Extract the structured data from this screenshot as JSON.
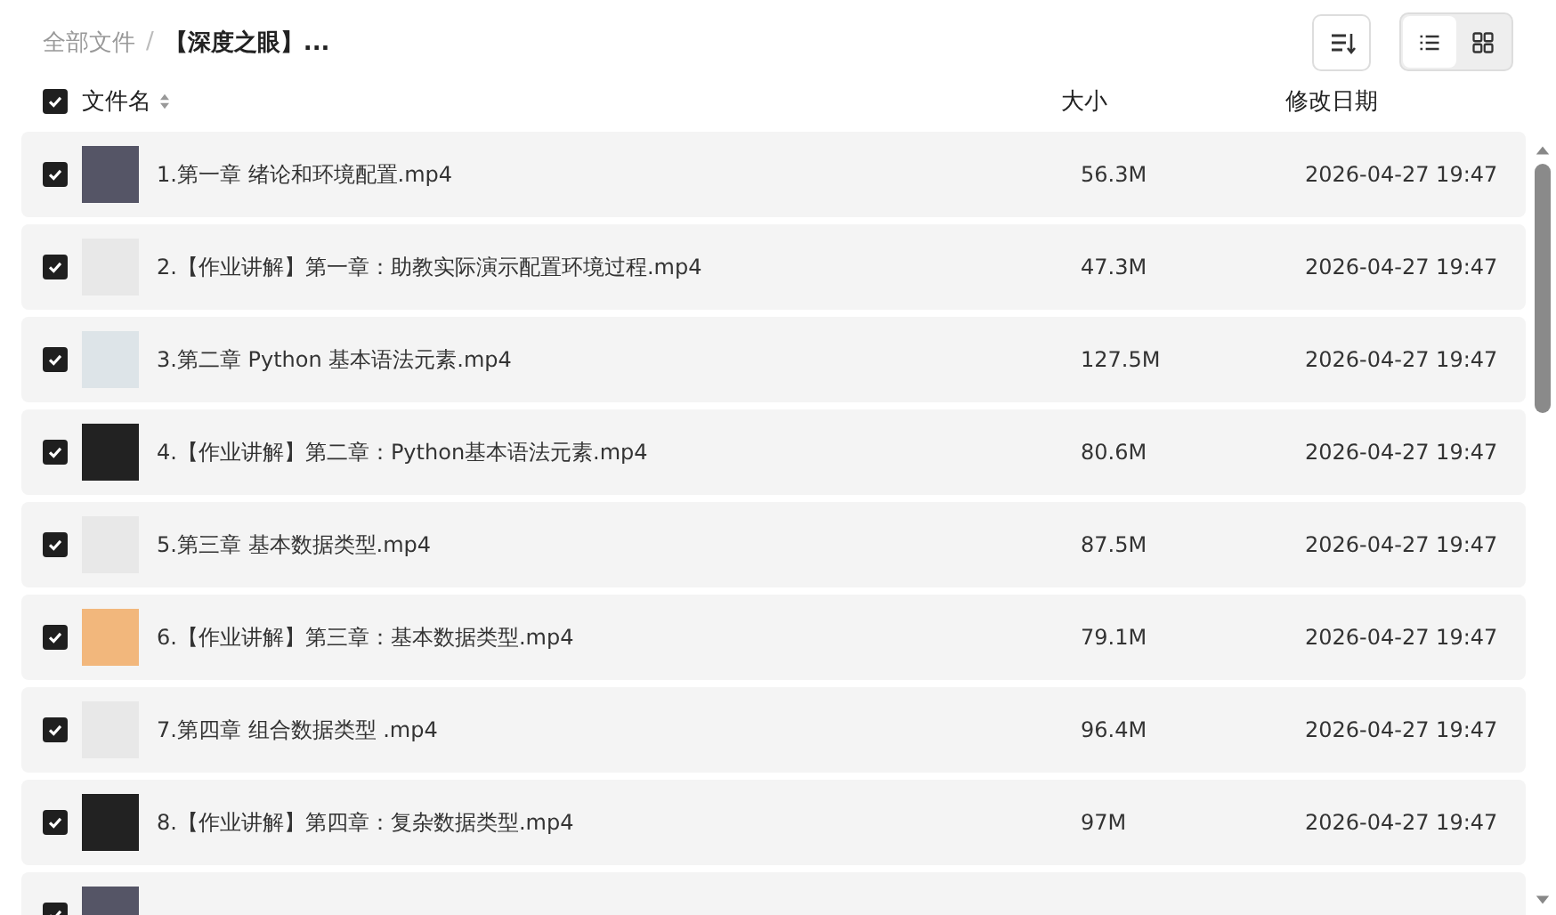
{
  "breadcrumb": [
    {
      "label": "全部文件",
      "current": false
    },
    {
      "label": "【深度之眼】...",
      "current": true
    }
  ],
  "separator": "/",
  "view_toggle": [
    {
      "kind": "list",
      "selected": true
    },
    {
      "kind": "grid",
      "selected": false
    }
  ],
  "header": {
    "checked": true,
    "columns": [
      "文件名",
      "大小",
      "修改日期"
    ]
  },
  "rows": [
    {
      "checked": true,
      "name": "1.第一章 绪论和环境配置.mp4",
      "size": "56.3M",
      "modified": "2026-04-27 19:47"
    },
    {
      "checked": true,
      "name": "2.【作业讲解】第一章：助教实际演示配置环境过程.mp4",
      "size": "47.3M",
      "modified": "2026-04-27 19:47"
    },
    {
      "checked": true,
      "name": "3.第二章 Python 基本语法元素.mp4",
      "size": "127.5M",
      "modified": "2026-04-27 19:47"
    },
    {
      "checked": true,
      "name": "4.【作业讲解】第二章：Python基本语法元素.mp4",
      "size": "80.6M",
      "modified": "2026-04-27 19:47"
    },
    {
      "checked": true,
      "name": "5.第三章 基本数据类型.mp4",
      "size": "87.5M",
      "modified": "2026-04-27 19:47"
    },
    {
      "checked": true,
      "name": "6.【作业讲解】第三章：基本数据类型.mp4",
      "size": "79.1M",
      "modified": "2026-04-27 19:47"
    },
    {
      "checked": true,
      "name": "7.第四章 组合数据类型 .mp4",
      "size": "96.4M",
      "modified": "2026-04-27 19:47"
    },
    {
      "checked": true,
      "name": "8.【作业讲解】第四章：复杂数据类型.mp4",
      "size": "97M",
      "modified": "2026-04-27 19:47"
    },
    {
      "checked": true
    }
  ]
}
